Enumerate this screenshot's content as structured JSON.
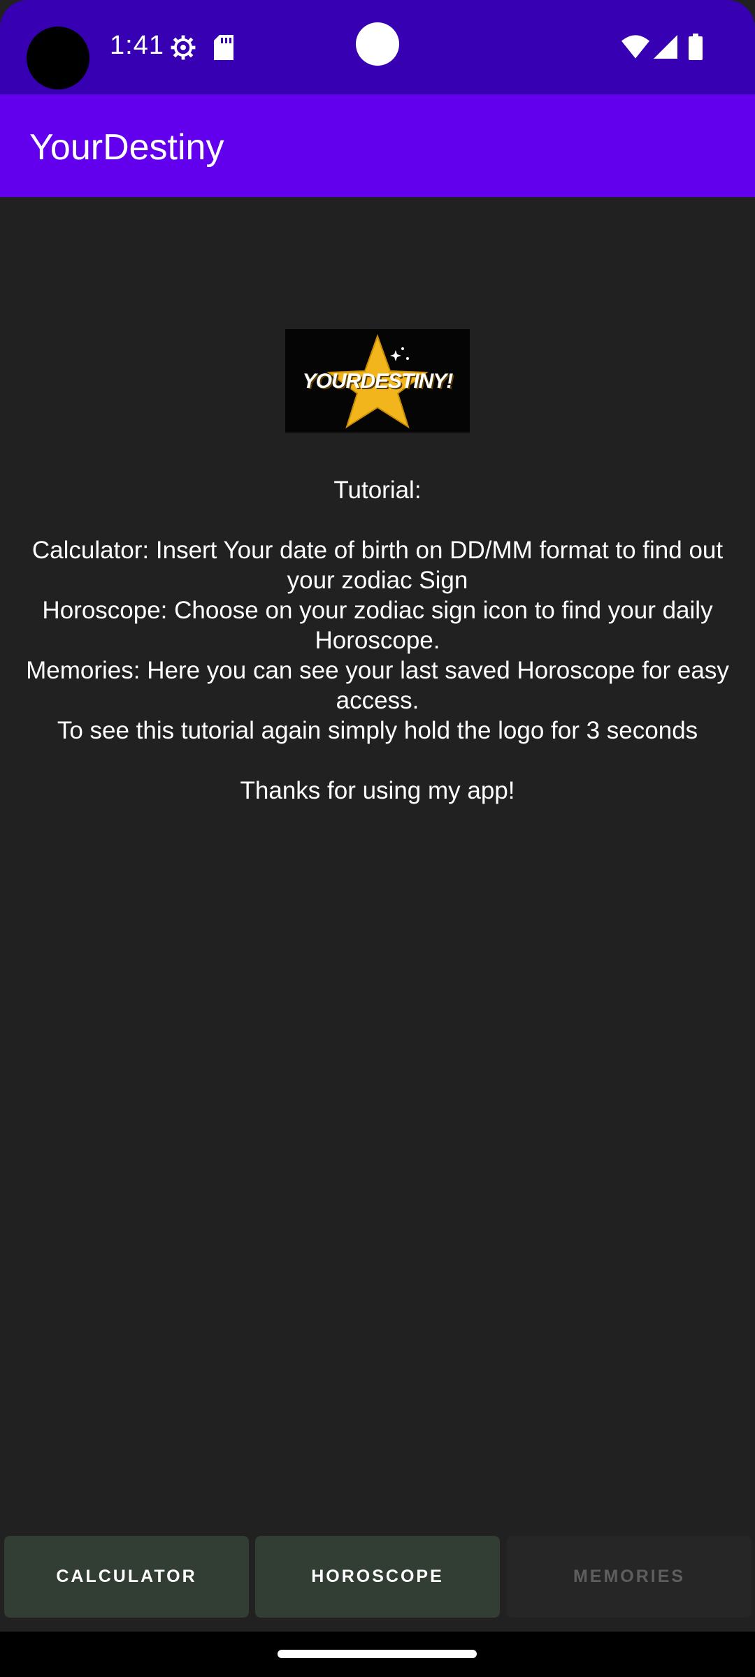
{
  "status_bar": {
    "time": "1:41",
    "icons": [
      "settings-gear-icon",
      "sd-card-icon",
      "wifi-icon",
      "cell-signal-icon",
      "battery-icon"
    ]
  },
  "app_bar": {
    "title": "YourDestiny"
  },
  "logo": {
    "text": "YOURDESTINY!",
    "colors": {
      "star": "#f2b51c",
      "background": "#050505"
    }
  },
  "tutorial": {
    "heading": "Tutorial:",
    "lines": [
      "Calculator: Insert Your date of birth on DD/MM format to find out your zodiac Sign",
      "Horoscope: Choose on your zodiac sign icon to find your daily Horoscope.",
      "Memories: Here you can see your last saved Horoscope for easy access.",
      "To see this tutorial again simply hold the logo for 3 seconds"
    ],
    "closing": "Thanks for using my app!"
  },
  "bottom_nav": {
    "calculator_label": "CALCULATOR",
    "horoscope_label": "HOROSCOPE",
    "memories_label": "MEMORIES"
  },
  "colors": {
    "status_bar": "#3700b3",
    "app_bar": "#6200ee",
    "background": "#212121",
    "button_active": "#323e34",
    "button_disabled": "#262626"
  }
}
